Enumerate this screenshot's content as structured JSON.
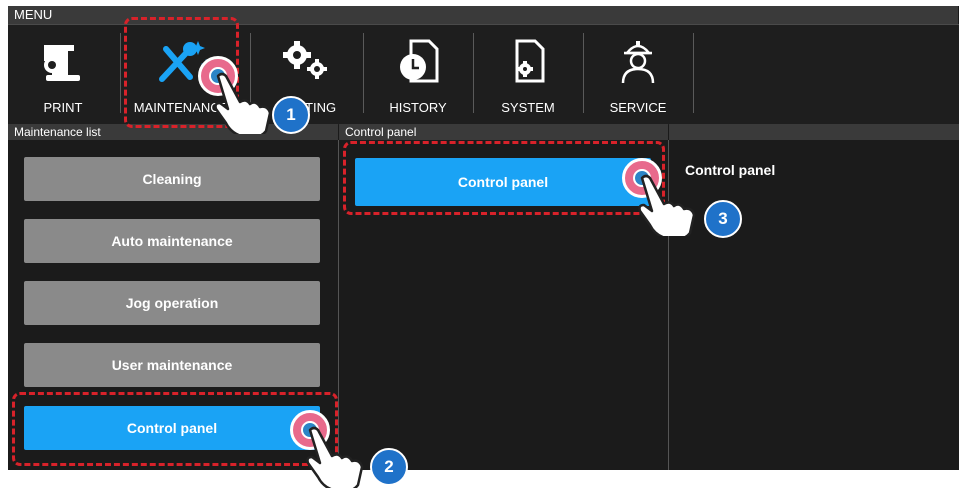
{
  "menu_title": "MENU",
  "toolbar": {
    "items": [
      {
        "label": "PRINT",
        "icon": "print-icon"
      },
      {
        "label": "MAINTENANCE",
        "icon": "maintenance-wrench-icon"
      },
      {
        "label": "SETTING",
        "icon": "gears-icon"
      },
      {
        "label": "HISTORY",
        "icon": "history-clock-icon"
      },
      {
        "label": "SYSTEM",
        "icon": "system-document-gear-icon"
      },
      {
        "label": "SERVICE",
        "icon": "service-worker-icon"
      }
    ]
  },
  "maintenance_list": {
    "header": "Maintenance list",
    "items": [
      "Cleaning",
      "Auto maintenance",
      "Jog operation",
      "User maintenance",
      "Control panel"
    ]
  },
  "control_panel": {
    "header": "Control panel",
    "button": "Control panel",
    "detail_title": "Control panel"
  },
  "steps": [
    "1",
    "2",
    "3"
  ],
  "colors": {
    "accent": "#1aa3f5",
    "button_gray": "#8a8a8a",
    "highlight_dash": "#d8222a",
    "step_badge": "#1f72c9"
  }
}
